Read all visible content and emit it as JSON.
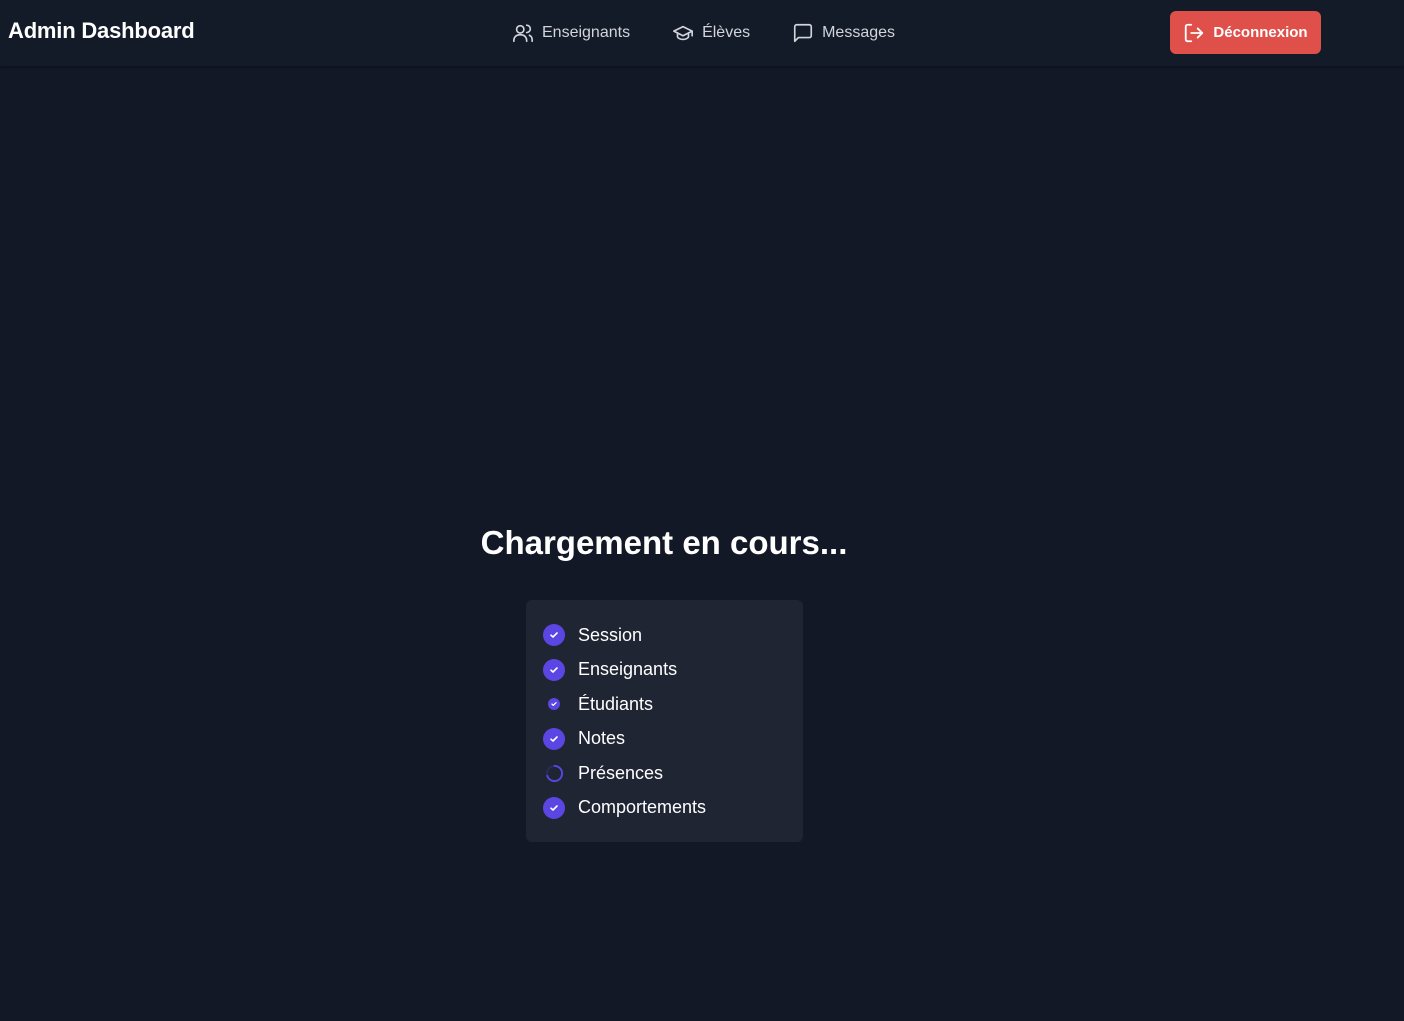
{
  "header": {
    "brand": "Admin Dashboard",
    "nav": [
      {
        "label": "Enseignants",
        "icon": "users-icon"
      },
      {
        "label": "Élèves",
        "icon": "graduation-cap-icon"
      },
      {
        "label": "Messages",
        "icon": "message-square-icon"
      }
    ],
    "logout_label": "Déconnexion",
    "logout_icon": "log-out-icon"
  },
  "loading": {
    "title": "Chargement en cours...",
    "steps": [
      {
        "label": "Session",
        "status": "done"
      },
      {
        "label": "Enseignants",
        "status": "done"
      },
      {
        "label": "Étudiants",
        "status": "done-small"
      },
      {
        "label": "Notes",
        "status": "done"
      },
      {
        "label": "Présences",
        "status": "loading"
      },
      {
        "label": "Comportements",
        "status": "done"
      }
    ]
  },
  "colors": {
    "background": "#121826",
    "panel": "#1f2533",
    "accent": "#5b46e3",
    "logout": "#e0504a"
  }
}
